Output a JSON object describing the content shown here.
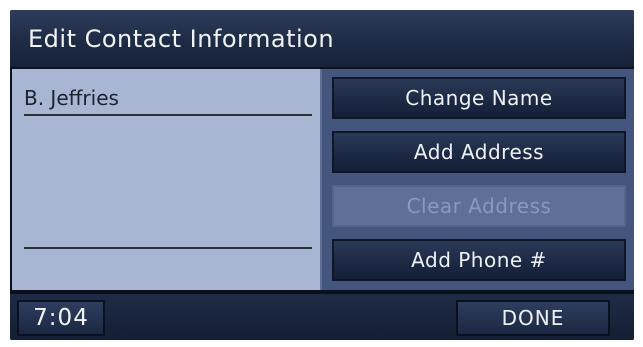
{
  "window": {
    "title": "Edit Contact Information"
  },
  "contact": {
    "name": "B. Jeffries",
    "second_line": ""
  },
  "actions": [
    {
      "label": "Change Name",
      "enabled": true
    },
    {
      "label": "Add Address",
      "enabled": true
    },
    {
      "label": "Clear Address",
      "enabled": false
    },
    {
      "label": "Add Phone #",
      "enabled": true
    }
  ],
  "footer": {
    "clock": "7:04",
    "done_label": "DONE"
  },
  "colors": {
    "title_bar": "#1e2b45",
    "detail_panel": "#a9b6d3",
    "side_panel": "#45567e",
    "button": "#1c2842",
    "button_disabled": "#5f6f97",
    "text_light": "#eef1f7",
    "text_dark": "#1c2230"
  }
}
